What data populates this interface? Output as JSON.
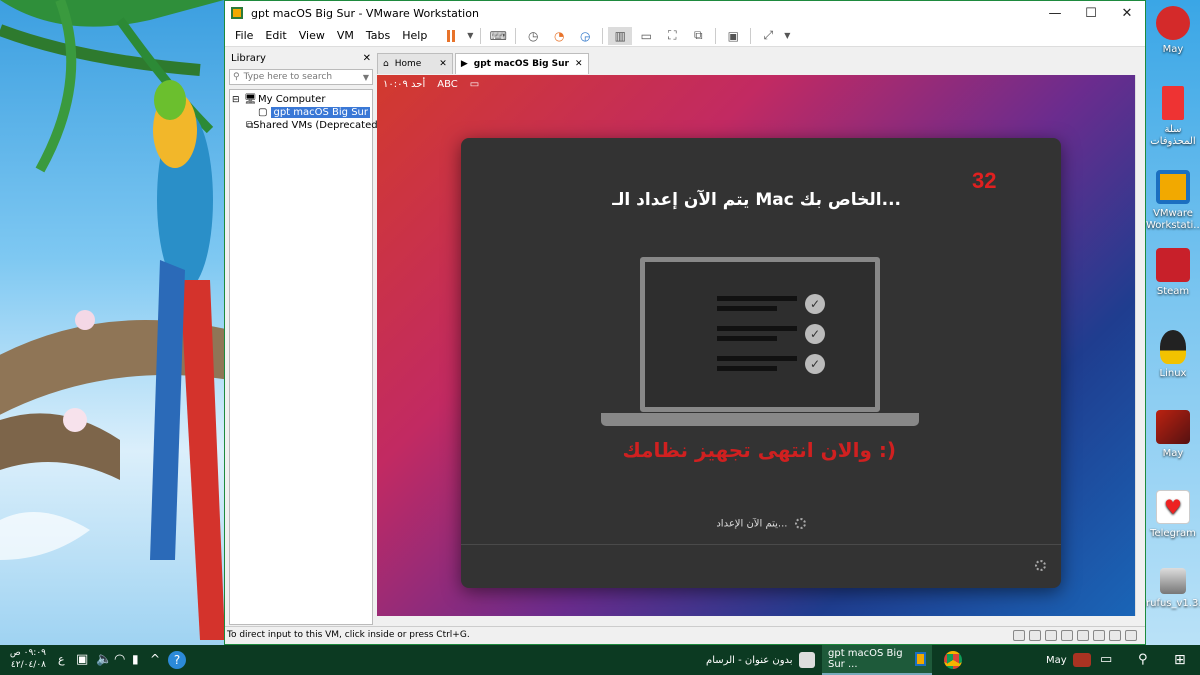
{
  "window": {
    "title": "gpt macOS Big Sur - VMware Workstation",
    "minimize": "—",
    "maximize": "☐",
    "close": "✕"
  },
  "menu": [
    "File",
    "Edit",
    "View",
    "VM",
    "Tabs",
    "Help"
  ],
  "library": {
    "title": "Library",
    "close": "✕",
    "search_placeholder": "Type here to search",
    "tree": {
      "my_computer": "My Computer",
      "vm": "gpt macOS Big Sur",
      "shared": "Shared VMs (Deprecated)"
    }
  },
  "tabs": {
    "home": "Home",
    "vm": "gpt macOS Big Sur",
    "close": "✕"
  },
  "mac": {
    "clock": "أحد ١٠:٠٩",
    "input": "ABC",
    "counter": "32",
    "title": "يتم الآن إعداد الـ Mac الخاص بك...",
    "annotation": "والان انتهى تجهيز نظامك :)",
    "status": "يتم الآن الإعداد..."
  },
  "statusbar": {
    "hint": "To direct input to this VM, click inside or press Ctrl+G."
  },
  "desktop_icons": [
    "May",
    "سلة المحذوفات",
    "VMware Workstati...",
    "Steam",
    "Linux",
    "May",
    "Telegram",
    "rufus_v1.3.4"
  ],
  "taskbar": {
    "time": "٠٩:٠٩ ص",
    "date": "٤٢/٠٤/٠٨",
    "lang": "ع",
    "paint": "بدون عنوان - الرسام",
    "vmware": "gpt macOS Big Sur ...",
    "may": "May"
  },
  "colors": {
    "accent_green": "#1e8a3e",
    "annotation_red": "#d02020",
    "taskbar": "#0c3a22"
  }
}
